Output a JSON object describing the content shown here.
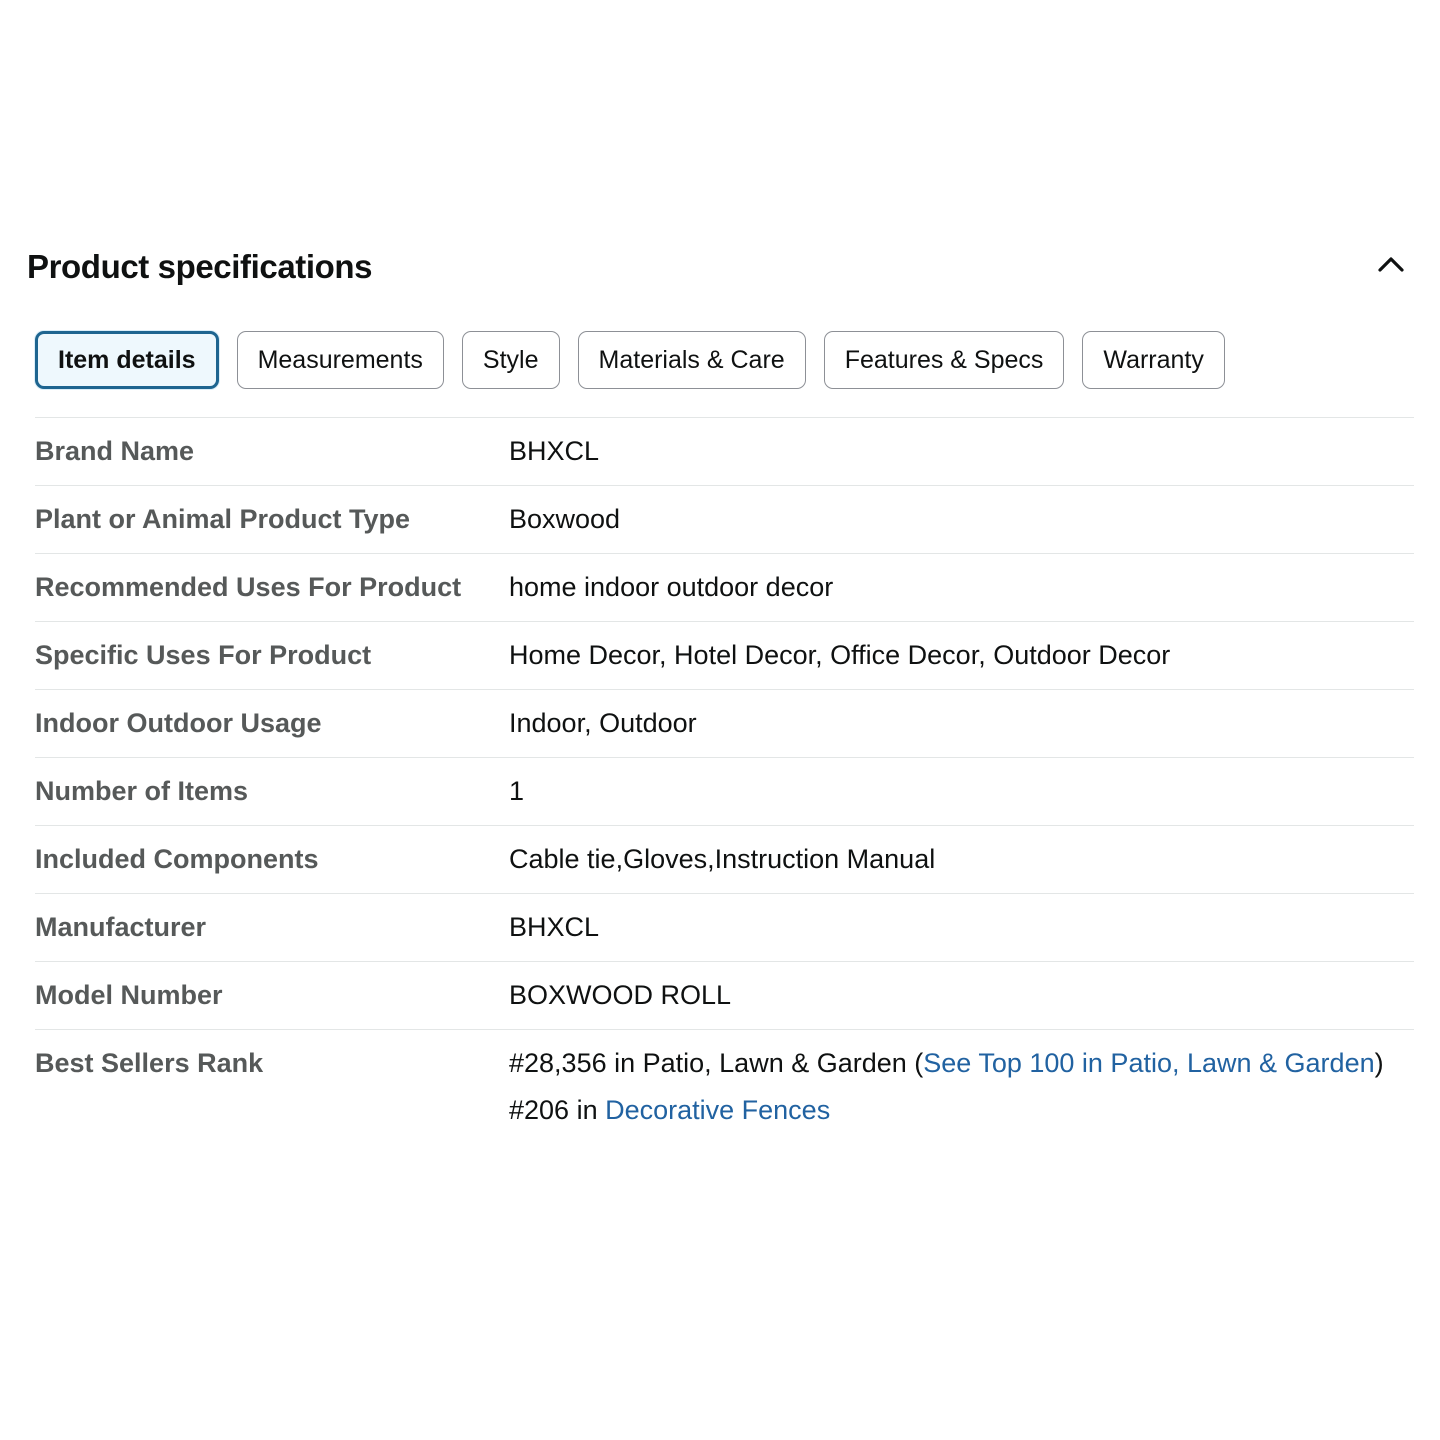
{
  "section": {
    "title": "Product specifications",
    "collapse_icon": "chevron-up-icon"
  },
  "tabs": [
    {
      "label": "Item details",
      "active": true
    },
    {
      "label": "Measurements",
      "active": false
    },
    {
      "label": "Style",
      "active": false
    },
    {
      "label": "Materials & Care",
      "active": false
    },
    {
      "label": "Features & Specs",
      "active": false
    },
    {
      "label": "Warranty",
      "active": false
    }
  ],
  "specs": [
    {
      "label": "Brand Name",
      "value": "BHXCL"
    },
    {
      "label": "Plant or Animal Product Type",
      "value": "Boxwood"
    },
    {
      "label": "Recommended Uses For Product",
      "value": "home indoor outdoor decor"
    },
    {
      "label": "Specific Uses For Product",
      "value": "Home Decor, Hotel Decor, Office Decor, Outdoor Decor"
    },
    {
      "label": "Indoor Outdoor Usage",
      "value": "Indoor, Outdoor"
    },
    {
      "label": "Number of Items",
      "value": "1"
    },
    {
      "label": "Included Components",
      "value": "Cable tie,Gloves,Instruction Manual"
    },
    {
      "label": "Manufacturer",
      "value": "BHXCL"
    },
    {
      "label": "Model Number",
      "value": "BOXWOOD ROLL"
    }
  ],
  "best_sellers": {
    "label": "Best Sellers Rank",
    "rank1_prefix": "#28,356 in Patio, Lawn & Garden (",
    "rank1_link": "See Top 100 in Patio, Lawn & Garden",
    "rank1_suffix": ")",
    "rank2_prefix": "#206 in ",
    "rank2_link": "Decorative Fences"
  },
  "colors": {
    "active_tab_border": "#1e6590",
    "active_tab_bg": "#eef8fd",
    "label_text": "#565959",
    "link": "#2162a1",
    "divider": "#e3e6e6"
  }
}
